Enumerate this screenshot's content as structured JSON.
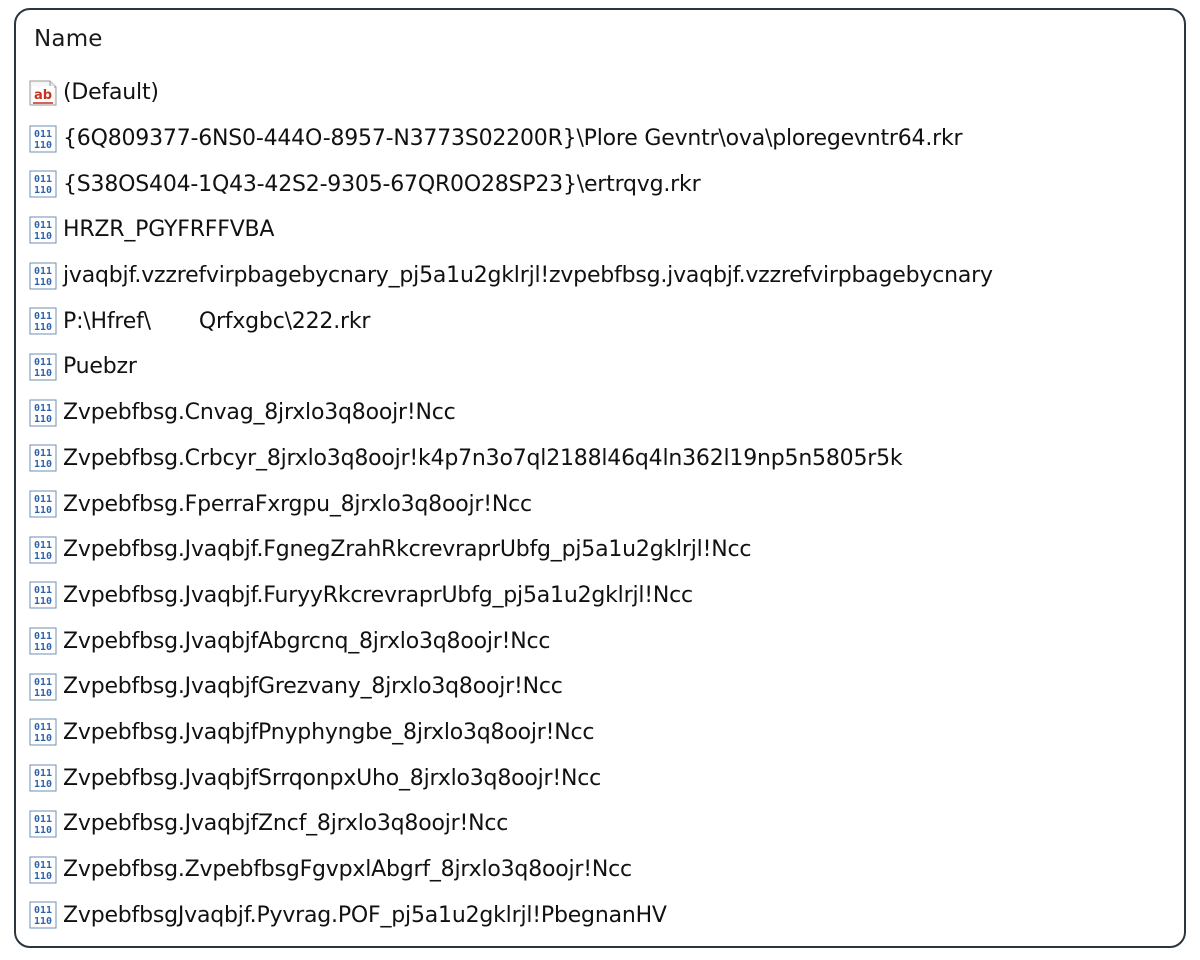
{
  "header": {
    "column_name": "Name"
  },
  "values": [
    {
      "type": "string",
      "icon": "string-value-icon",
      "name": "(Default)"
    },
    {
      "type": "binary",
      "icon": "binary-value-icon",
      "name": "{6Q809377-6NS0-444O-8957-N3773S02200R}\\Plore Gevntr\\ova\\ploregevntr64.rkr"
    },
    {
      "type": "binary",
      "icon": "binary-value-icon",
      "name": "{S38OS404-1Q43-42S2-9305-67QR0O28SP23}\\ertrqvg.rkr"
    },
    {
      "type": "binary",
      "icon": "binary-value-icon",
      "name": "HRZR_PGYFRFFVBA"
    },
    {
      "type": "binary",
      "icon": "binary-value-icon",
      "name": "jvaqbjf.vzzrefvirpbagebycnary_pj5a1u2gklrjl!zvpebfbsg.jvaqbjf.vzzrefvirpbagebycnary"
    },
    {
      "type": "binary",
      "icon": "binary-value-icon",
      "name_prefix": "P:\\Hfref\\",
      "name_suffix": "Qrfxgbc\\222.rkr"
    },
    {
      "type": "binary",
      "icon": "binary-value-icon",
      "name": "Puebzr"
    },
    {
      "type": "binary",
      "icon": "binary-value-icon",
      "name": "Zvpebfbsg.Cnvag_8jrxlo3q8oojr!Ncc"
    },
    {
      "type": "binary",
      "icon": "binary-value-icon",
      "name": "Zvpebfbsg.Crbcyr_8jrxlo3q8oojr!k4p7n3o7ql2188l46q4ln362l19np5n5805r5k"
    },
    {
      "type": "binary",
      "icon": "binary-value-icon",
      "name": "Zvpebfbsg.FperraFxrgpu_8jrxlo3q8oojr!Ncc"
    },
    {
      "type": "binary",
      "icon": "binary-value-icon",
      "name": "Zvpebfbsg.Jvaqbjf.FgnegZrahRkcrevraprUbfg_pj5a1u2gklrjl!Ncc"
    },
    {
      "type": "binary",
      "icon": "binary-value-icon",
      "name": "Zvpebfbsg.Jvaqbjf.FuryyRkcrevraprUbfg_pj5a1u2gklrjl!Ncc"
    },
    {
      "type": "binary",
      "icon": "binary-value-icon",
      "name": "Zvpebfbsg.JvaqbjfAbgrcnq_8jrxlo3q8oojr!Ncc"
    },
    {
      "type": "binary",
      "icon": "binary-value-icon",
      "name": "Zvpebfbsg.JvaqbjfGrezvany_8jrxlo3q8oojr!Ncc"
    },
    {
      "type": "binary",
      "icon": "binary-value-icon",
      "name": "Zvpebfbsg.JvaqbjfPnyphyngbe_8jrxlo3q8oojr!Ncc"
    },
    {
      "type": "binary",
      "icon": "binary-value-icon",
      "name": "Zvpebfbsg.JvaqbjfSrrqonpxUho_8jrxlo3q8oojr!Ncc"
    },
    {
      "type": "binary",
      "icon": "binary-value-icon",
      "name": "Zvpebfbsg.JvaqbjfZncf_8jrxlo3q8oojr!Ncc"
    },
    {
      "type": "binary",
      "icon": "binary-value-icon",
      "name": "Zvpebfbsg.ZvpebfbsgFgvpxlAbgrf_8jrxlo3q8oojr!Ncc"
    },
    {
      "type": "binary",
      "icon": "binary-value-icon",
      "name": "ZvpebfbsgJvaqbjf.Pyvrag.POF_pj5a1u2gklrjl!PbegnanHV"
    }
  ]
}
